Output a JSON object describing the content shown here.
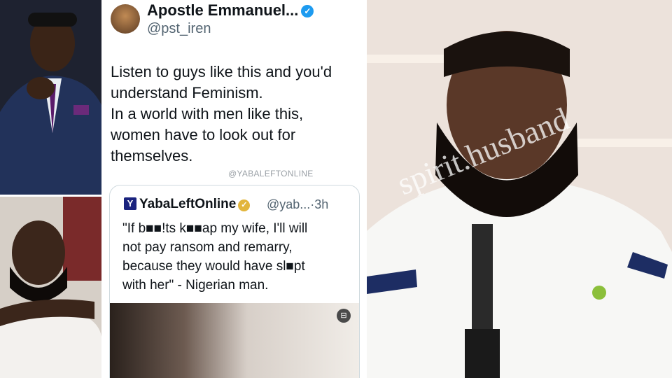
{
  "tweet": {
    "author": "Apostle Emmanuel...",
    "handle": "@pst_iren",
    "text_lines": [
      "Listen to guys like this and you'd",
      "understand Feminism.",
      "In a world with men like this,",
      "women have to look out for",
      "themselves."
    ],
    "image_watermark": "@YABALEFTONLINE",
    "quote": {
      "logo": "Y",
      "name": "YabaLeftOnline",
      "handle_time": "@yab...·3h",
      "text_lines": [
        "\"If b■■!ts k■■ap my wife, I'll will",
        "not pay ransom and  remarry,",
        "because they would have sl■pt",
        "with her\" - Nigerian man."
      ]
    }
  },
  "overlay_watermark": "spirit.husband",
  "icons": {
    "verified": "verified-badge-icon",
    "gold_check": "gold-check-icon",
    "media_button": "media-more-icon"
  },
  "colors": {
    "verified_blue": "#1d9bf0",
    "text_dark": "#0f1419",
    "text_muted": "#536471",
    "gold": "#e2b53b"
  }
}
